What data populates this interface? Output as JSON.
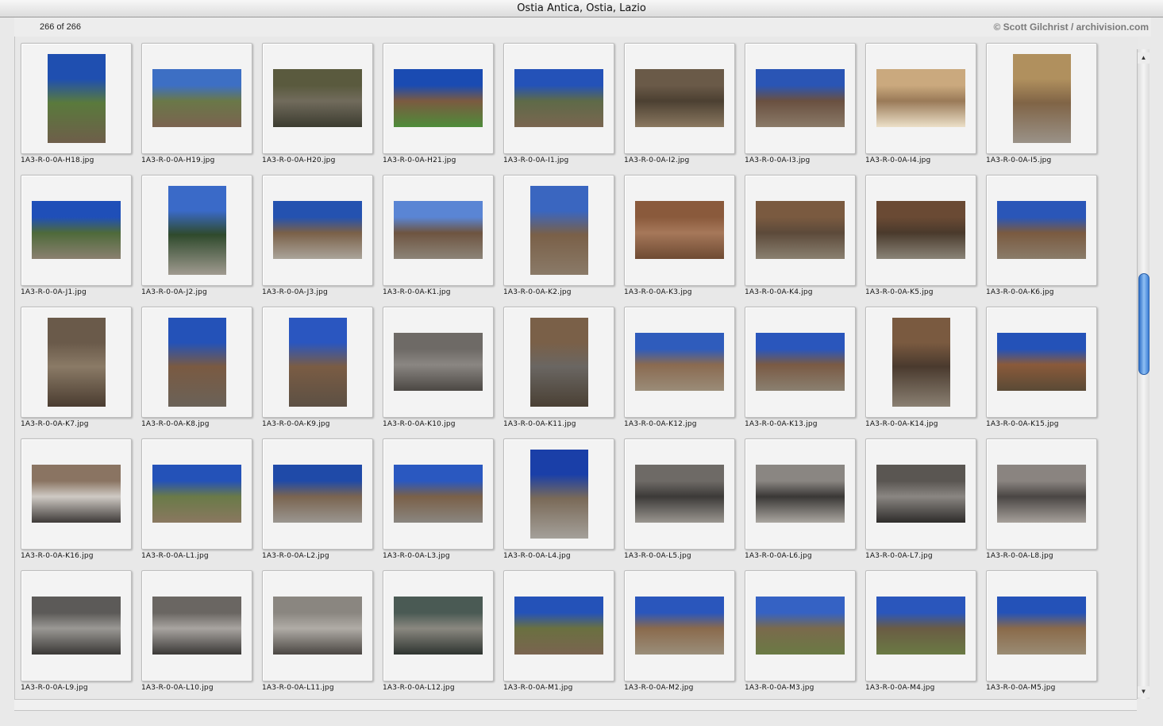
{
  "window": {
    "title": "Ostia Antica, Ostia, Lazio"
  },
  "header": {
    "count": "266 of 266",
    "credit": "© Scott Gilchrist / archivision.com"
  },
  "photos": [
    {
      "file": "1A3-R-0-0A-H18.jpg",
      "orient": "port",
      "colors": [
        "#1f4fb0",
        "#5a7a3c",
        "#6e5e4a"
      ]
    },
    {
      "file": "1A3-R-0-0A-H19.jpg",
      "orient": "land",
      "colors": [
        "#3d6fc4",
        "#6a7848",
        "#7a6350"
      ]
    },
    {
      "file": "1A3-R-0-0A-H20.jpg",
      "orient": "land",
      "colors": [
        "#5a5a3e",
        "#716b5c",
        "#3c3c30"
      ]
    },
    {
      "file": "1A3-R-0-0A-H21.jpg",
      "orient": "land",
      "colors": [
        "#1a4bb2",
        "#7b5a40",
        "#4e8c3a"
      ]
    },
    {
      "file": "1A3-R-0-0A-I1.jpg",
      "orient": "land",
      "colors": [
        "#2452b8",
        "#5e6a48",
        "#7a6650"
      ]
    },
    {
      "file": "1A3-R-0-0A-I2.jpg",
      "orient": "land",
      "colors": [
        "#6a5a48",
        "#4c4032",
        "#8a7860"
      ]
    },
    {
      "file": "1A3-R-0-0A-I3.jpg",
      "orient": "land",
      "colors": [
        "#2a55b5",
        "#6a5040",
        "#8a7a68"
      ]
    },
    {
      "file": "1A3-R-0-0A-I4.jpg",
      "orient": "land",
      "colors": [
        "#caa97e",
        "#9a7a58",
        "#ece0c8"
      ]
    },
    {
      "file": "1A3-R-0-0A-I5.jpg",
      "orient": "port",
      "colors": [
        "#b0905e",
        "#806446",
        "#9a9288"
      ]
    },
    {
      "file": "1A3-R-0-0A-J1.jpg",
      "orient": "land",
      "colors": [
        "#1f4fb8",
        "#4e6a3a",
        "#8a8070"
      ]
    },
    {
      "file": "1A3-R-0-0A-J2.jpg",
      "orient": "port",
      "colors": [
        "#3a6ac8",
        "#2f4a2c",
        "#a09a90"
      ]
    },
    {
      "file": "1A3-R-0-0A-J3.jpg",
      "orient": "land",
      "colors": [
        "#2452b0",
        "#7a6048",
        "#aaa49a"
      ]
    },
    {
      "file": "1A3-R-0-0A-K1.jpg",
      "orient": "land",
      "colors": [
        "#5a85d4",
        "#6e5440",
        "#8c8478"
      ]
    },
    {
      "file": "1A3-R-0-0A-K2.jpg",
      "orient": "port",
      "colors": [
        "#3a66c0",
        "#7a6048",
        "#8a7a68"
      ]
    },
    {
      "file": "1A3-R-0-0A-K3.jpg",
      "orient": "land",
      "colors": [
        "#8a5a3c",
        "#a6785a",
        "#6e4a32"
      ]
    },
    {
      "file": "1A3-R-0-0A-K4.jpg",
      "orient": "land",
      "colors": [
        "#7a5a40",
        "#5c4a3a",
        "#8a8070"
      ]
    },
    {
      "file": "1A3-R-0-0A-K5.jpg",
      "orient": "land",
      "colors": [
        "#6a4a34",
        "#4a3a2c",
        "#8a8478"
      ]
    },
    {
      "file": "1A3-R-0-0A-K6.jpg",
      "orient": "land",
      "colors": [
        "#2a56b8",
        "#7a5a40",
        "#8a7c6a"
      ]
    },
    {
      "file": "1A3-R-0-0A-K7.jpg",
      "orient": "port",
      "colors": [
        "#6a5a4a",
        "#8a7a66",
        "#4a3c30"
      ]
    },
    {
      "file": "1A3-R-0-0A-K8.jpg",
      "orient": "port",
      "colors": [
        "#2452b8",
        "#7a5a42",
        "#6a6258"
      ]
    },
    {
      "file": "1A3-R-0-0A-K9.jpg",
      "orient": "port",
      "colors": [
        "#2a56c0",
        "#7a5c44",
        "#5c5044"
      ]
    },
    {
      "file": "1A3-R-0-0A-K10.jpg",
      "orient": "land",
      "colors": [
        "#6e6a66",
        "#8a8682",
        "#4c4844"
      ]
    },
    {
      "file": "1A3-R-0-0A-K11.jpg",
      "orient": "port",
      "colors": [
        "#7a6048",
        "#6a6662",
        "#4a4034"
      ]
    },
    {
      "file": "1A3-R-0-0A-K12.jpg",
      "orient": "land",
      "colors": [
        "#2f5cbc",
        "#8a6a50",
        "#9a8c78"
      ]
    },
    {
      "file": "1A3-R-0-0A-K13.jpg",
      "orient": "land",
      "colors": [
        "#2a56bc",
        "#7a5a44",
        "#8a8070"
      ]
    },
    {
      "file": "1A3-R-0-0A-K14.jpg",
      "orient": "port",
      "colors": [
        "#7a5a40",
        "#4a3a2e",
        "#8a8072"
      ]
    },
    {
      "file": "1A3-R-0-0A-K15.jpg",
      "orient": "land",
      "colors": [
        "#2452b8",
        "#8a5a3a",
        "#5a4a36"
      ]
    },
    {
      "file": "1A3-R-0-0A-K16.jpg",
      "orient": "land",
      "colors": [
        "#8a7462",
        "#cfcac4",
        "#3e3a38"
      ]
    },
    {
      "file": "1A3-R-0-0A-L1.jpg",
      "orient": "land",
      "colors": [
        "#2452b8",
        "#6a7a48",
        "#8a7860"
      ]
    },
    {
      "file": "1A3-R-0-0A-L2.jpg",
      "orient": "land",
      "colors": [
        "#1f4aa8",
        "#7a6450",
        "#9a9690"
      ]
    },
    {
      "file": "1A3-R-0-0A-L3.jpg",
      "orient": "land",
      "colors": [
        "#2a58c0",
        "#7a6048",
        "#8a8680"
      ]
    },
    {
      "file": "1A3-R-0-0A-L4.jpg",
      "orient": "port",
      "colors": [
        "#1a3fa8",
        "#7a6a58",
        "#a4a09a"
      ]
    },
    {
      "file": "1A3-R-0-0A-L5.jpg",
      "orient": "land",
      "colors": [
        "#6e6a66",
        "#3c3a38",
        "#9a9690"
      ]
    },
    {
      "file": "1A3-R-0-0A-L6.jpg",
      "orient": "land",
      "colors": [
        "#8a8682",
        "#3a3836",
        "#aaa6a0"
      ]
    },
    {
      "file": "1A3-R-0-0A-L7.jpg",
      "orient": "land",
      "colors": [
        "#5a5652",
        "#8a8682",
        "#2e2c2a"
      ]
    },
    {
      "file": "1A3-R-0-0A-L8.jpg",
      "orient": "land",
      "colors": [
        "#8a8480",
        "#4a4644",
        "#a6a09a"
      ]
    },
    {
      "file": "1A3-R-0-0A-L9.jpg",
      "orient": "land",
      "colors": [
        "#5c5a58",
        "#9a9894",
        "#3a3836"
      ]
    },
    {
      "file": "1A3-R-0-0A-L10.jpg",
      "orient": "land",
      "colors": [
        "#6a6662",
        "#a8a4a0",
        "#3a3836"
      ]
    },
    {
      "file": "1A3-R-0-0A-L11.jpg",
      "orient": "land",
      "colors": [
        "#8a8680",
        "#b0aca6",
        "#4a4642"
      ]
    },
    {
      "file": "1A3-R-0-0A-L12.jpg",
      "orient": "land",
      "colors": [
        "#4a5a54",
        "#8a8880",
        "#2e3430"
      ]
    },
    {
      "file": "1A3-R-0-0A-M1.jpg",
      "orient": "land",
      "colors": [
        "#2452b8",
        "#6a7040",
        "#7a6450"
      ]
    },
    {
      "file": "1A3-R-0-0A-M2.jpg",
      "orient": "land",
      "colors": [
        "#2a56bc",
        "#8a6a4c",
        "#9a8e7a"
      ]
    },
    {
      "file": "1A3-R-0-0A-M3.jpg",
      "orient": "land",
      "colors": [
        "#3562c4",
        "#7a6a4c",
        "#6a7a44"
      ]
    },
    {
      "file": "1A3-R-0-0A-M4.jpg",
      "orient": "land",
      "colors": [
        "#2a56bc",
        "#6a5c44",
        "#6a7a44"
      ]
    },
    {
      "file": "1A3-R-0-0A-M5.jpg",
      "orient": "land",
      "colors": [
        "#2452b8",
        "#8a6a4a",
        "#9a8c74"
      ]
    }
  ]
}
